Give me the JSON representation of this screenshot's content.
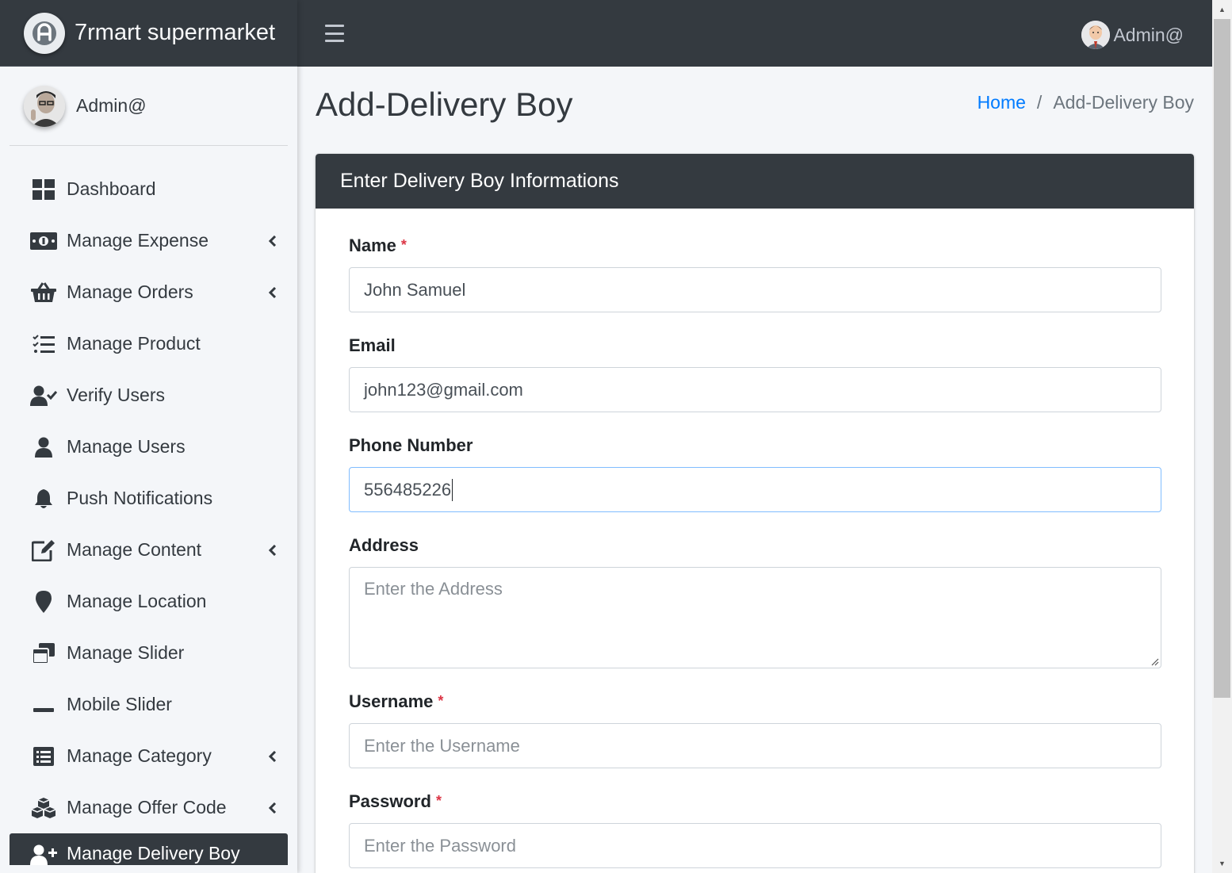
{
  "brand": {
    "name": "7rmart supermarket"
  },
  "sidebar_user": {
    "name": "Admin@"
  },
  "sidebar": {
    "items": [
      {
        "label": "Dashboard",
        "icon": "dashboard-icon",
        "has_chevron": false
      },
      {
        "label": "Manage Expense",
        "icon": "money-bill-icon",
        "has_chevron": true
      },
      {
        "label": "Manage Orders",
        "icon": "shopping-basket-icon",
        "has_chevron": true
      },
      {
        "label": "Manage Product",
        "icon": "tasks-list-icon",
        "has_chevron": false
      },
      {
        "label": "Verify Users",
        "icon": "user-check-icon",
        "has_chevron": false
      },
      {
        "label": "Manage Users",
        "icon": "user-icon",
        "has_chevron": false
      },
      {
        "label": "Push Notifications",
        "icon": "bell-icon",
        "has_chevron": false
      },
      {
        "label": "Manage Content",
        "icon": "edit-icon",
        "has_chevron": true
      },
      {
        "label": "Manage Location",
        "icon": "map-marker-icon",
        "has_chevron": false
      },
      {
        "label": "Manage Slider",
        "icon": "window-restore-icon",
        "has_chevron": false
      },
      {
        "label": "Mobile Slider",
        "icon": "minus-icon",
        "has_chevron": false
      },
      {
        "label": "Manage Category",
        "icon": "list-alt-icon",
        "has_chevron": true
      },
      {
        "label": "Manage Offer Code",
        "icon": "cubes-icon",
        "has_chevron": true
      },
      {
        "label": "Manage Delivery Boy",
        "icon": "user-plus-icon",
        "has_chevron": false,
        "active": true
      }
    ]
  },
  "topbar": {
    "user_name": "Admin@"
  },
  "page": {
    "title": "Add-Delivery Boy",
    "breadcrumb": {
      "home": "Home",
      "separator": "/",
      "current": "Add-Delivery Boy"
    }
  },
  "card": {
    "header": "Enter Delivery Boy Informations",
    "fields": {
      "name": {
        "label": "Name",
        "required_mark": "*",
        "value": "John Samuel"
      },
      "email": {
        "label": "Email",
        "value": "john123@gmail.com"
      },
      "phone": {
        "label": "Phone Number",
        "value": "556485226"
      },
      "address": {
        "label": "Address",
        "placeholder": "Enter the Address"
      },
      "username": {
        "label": "Username",
        "required_mark": "*",
        "placeholder": "Enter the Username"
      },
      "password": {
        "label": "Password",
        "required_mark": "*",
        "placeholder": "Enter the Password"
      }
    }
  },
  "colors": {
    "dark": "#343a40",
    "link": "#007bff",
    "required": "#dc3545",
    "background": "#f4f6f9"
  }
}
